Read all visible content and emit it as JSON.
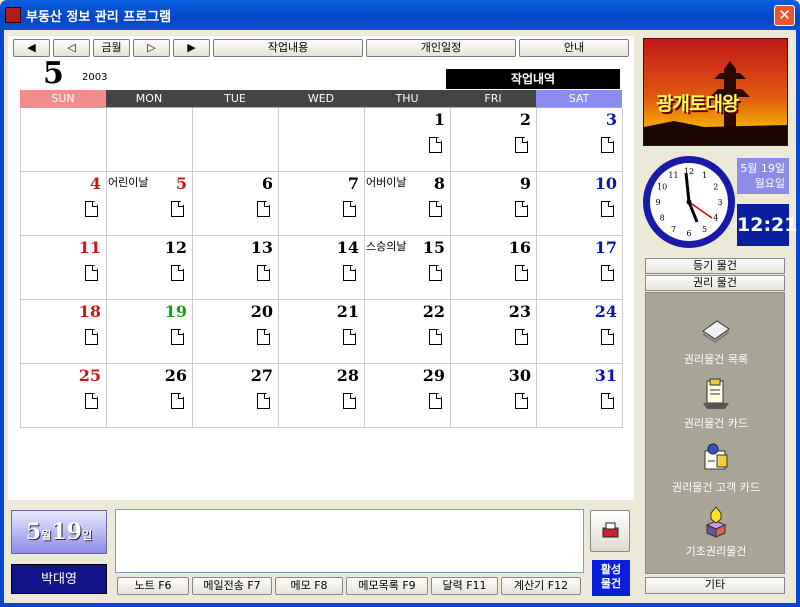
{
  "window": {
    "title": "부동산 정보 관리 프로그램"
  },
  "toolbar": {
    "prev_year": "◀",
    "prev_month": "◁",
    "this_month": "금월",
    "next_month": "▷",
    "next_year": "▶",
    "tab_work": "작업내용",
    "tab_personal": "개인일정",
    "tab_guide": "안내"
  },
  "calendar": {
    "month": "5",
    "year": "2003",
    "work_label": "작업내역",
    "days": [
      "SUN",
      "MON",
      "TUE",
      "WED",
      "THU",
      "FRI",
      "SAT"
    ],
    "day_colors": [
      "#f08c8c",
      "#444444",
      "#444444",
      "#444444",
      "#444444",
      "#444444",
      "#8c8cf0"
    ],
    "weeks": [
      [
        {
          "d": ""
        },
        {
          "d": ""
        },
        {
          "d": ""
        },
        {
          "d": ""
        },
        {
          "d": "1",
          "c": "#000"
        },
        {
          "d": "2",
          "c": "#000"
        },
        {
          "d": "3",
          "c": "#0a14b4"
        }
      ],
      [
        {
          "d": "4",
          "c": "#d21414"
        },
        {
          "d": "5",
          "c": "#d21414",
          "h": "어린이날"
        },
        {
          "d": "6",
          "c": "#000"
        },
        {
          "d": "7",
          "c": "#000"
        },
        {
          "d": "8",
          "c": "#000",
          "h": "어버이날"
        },
        {
          "d": "9",
          "c": "#000"
        },
        {
          "d": "10",
          "c": "#0a14b4"
        }
      ],
      [
        {
          "d": "11",
          "c": "#d21414"
        },
        {
          "d": "12",
          "c": "#000"
        },
        {
          "d": "13",
          "c": "#000"
        },
        {
          "d": "14",
          "c": "#000"
        },
        {
          "d": "15",
          "c": "#000",
          "h": "스승의날"
        },
        {
          "d": "16",
          "c": "#000"
        },
        {
          "d": "17",
          "c": "#0a14b4"
        }
      ],
      [
        {
          "d": "18",
          "c": "#d21414"
        },
        {
          "d": "19",
          "c": "#14a014"
        },
        {
          "d": "20",
          "c": "#000"
        },
        {
          "d": "21",
          "c": "#000"
        },
        {
          "d": "22",
          "c": "#000"
        },
        {
          "d": "23",
          "c": "#000"
        },
        {
          "d": "24",
          "c": "#0a14b4"
        }
      ],
      [
        {
          "d": "25",
          "c": "#d21414"
        },
        {
          "d": "26",
          "c": "#000"
        },
        {
          "d": "27",
          "c": "#000"
        },
        {
          "d": "28",
          "c": "#000"
        },
        {
          "d": "29",
          "c": "#000"
        },
        {
          "d": "30",
          "c": "#000"
        },
        {
          "d": "31",
          "c": "#0a14b4"
        }
      ]
    ]
  },
  "today": {
    "month": "5",
    "month_unit": "월",
    "day": "19",
    "day_unit": "일"
  },
  "user": {
    "name": "박대영"
  },
  "footer": {
    "buttons": [
      "노트 F6",
      "메일전송 F7",
      "메모 F8",
      "메모목록 F9",
      "달력 F11",
      "계산기 F12"
    ],
    "active": "활성\n물건"
  },
  "banner": {
    "text": "광개토대왕"
  },
  "clock": {
    "date_line1": "5월 19일",
    "date_line2": "월요일",
    "time": "12:21"
  },
  "side": {
    "tab_registered": "등기 물건",
    "tab_rights": "권리 물건",
    "items": [
      {
        "label": "권리물건 목록",
        "icon": "list-icon"
      },
      {
        "label": "권리물건 카드",
        "icon": "card-icon"
      },
      {
        "label": "권리물건 고객 카드",
        "icon": "customer-card-icon"
      },
      {
        "label": "기초권리물건",
        "icon": "basic-rights-icon"
      }
    ],
    "other": "기타"
  }
}
